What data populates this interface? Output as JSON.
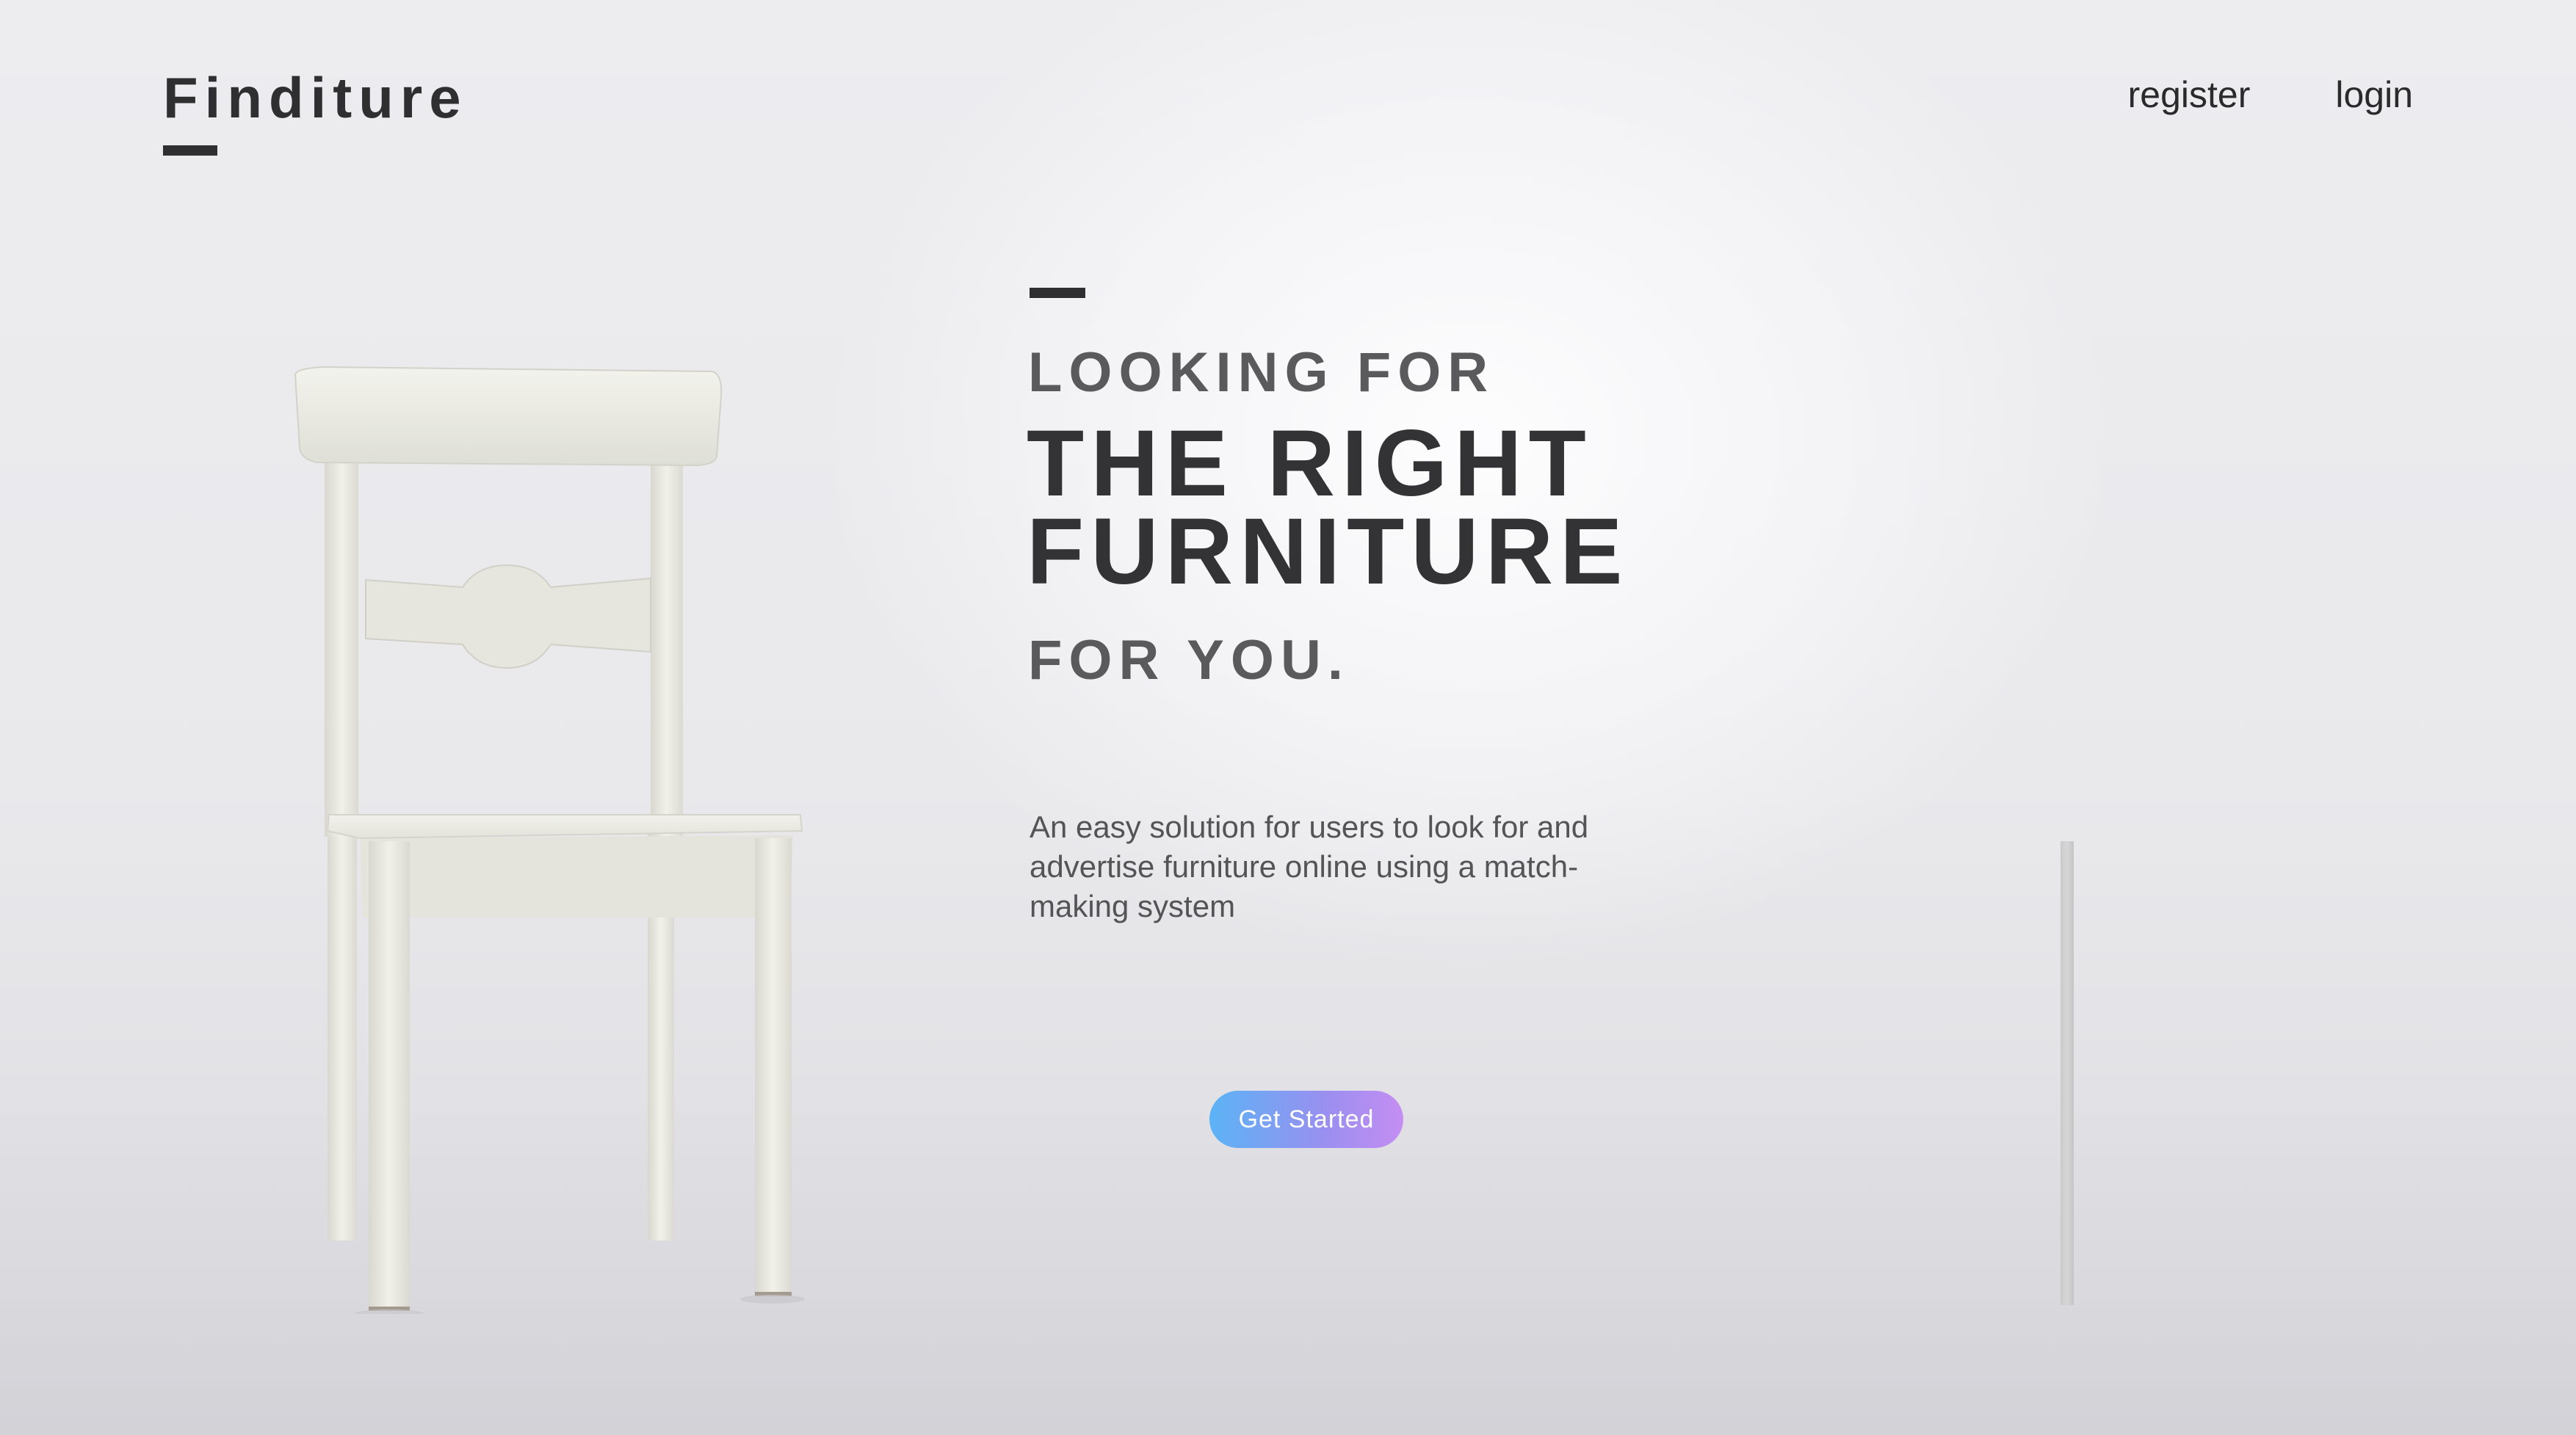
{
  "brand": {
    "name": "Finditure"
  },
  "nav": {
    "register": "register",
    "login": "login"
  },
  "hero": {
    "line1": "LOOKING FOR",
    "line2": "THE RIGHT",
    "line3": "FURNITURE",
    "line4": "FOR YOU.",
    "description": "An easy solution for users to look for and advertise furniture online using a match-making system",
    "cta": "Get Started"
  },
  "colors": {
    "text_dark": "#333335",
    "text_mid": "#5a5a5c",
    "cta_gradient_start": "#5bb3f5",
    "cta_gradient_end": "#c58ef2",
    "background": "#ececef"
  },
  "icons": {
    "hero_image": "white-chair-image"
  }
}
